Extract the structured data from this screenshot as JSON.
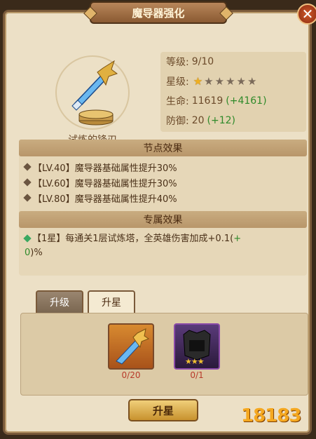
{
  "title": "魔导器强化",
  "close_label": "✕",
  "artifact": {
    "name": "试炼的锋刃"
  },
  "stats": {
    "level_label": "等级:",
    "level_value": "9/10",
    "star_label": "星级:",
    "stars_filled": 1,
    "stars_total": 6,
    "hp_label": "生命:",
    "hp_value": "11619",
    "hp_bonus": "(+4161)",
    "def_label": "防御:",
    "def_value": "20",
    "def_bonus": "(+12)"
  },
  "node_effects": {
    "header": "节点效果",
    "lines": [
      "【LV.40】魔导器基础属性提升30%",
      "【LV.60】魔导器基础属性提升30%",
      "【LV.80】魔导器基础属性提升40%"
    ]
  },
  "exclusive_effects": {
    "header": "专属效果",
    "prefix": "【1星】每通关1层试炼塔，全英雄伤害加成+0.1(",
    "bonus_a": "+",
    "break_a": "0",
    "suffix": ")%"
  },
  "tabs": [
    {
      "label": "升级",
      "active": false
    },
    {
      "label": "升星",
      "active": true
    }
  ],
  "materials": [
    {
      "count": "0/20"
    },
    {
      "count": "0/1",
      "stars": 3
    }
  ],
  "upstar_button": "升星",
  "watermark": "18183",
  "colors": {
    "bonus_green": "#2f8a2a",
    "count_red": "#b83a2a",
    "star_gold": "#f0b020"
  }
}
